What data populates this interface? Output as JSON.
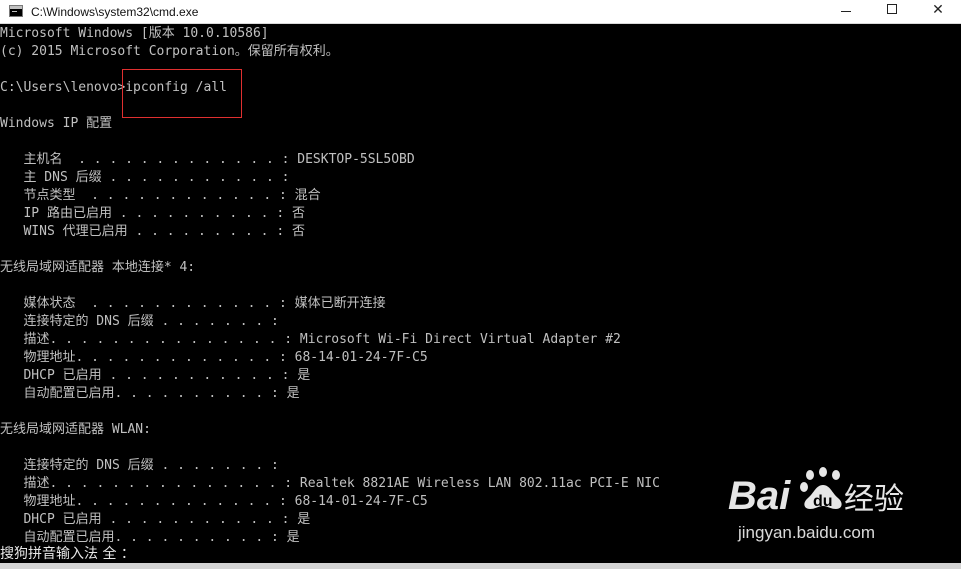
{
  "window": {
    "title": "C:\\Windows\\system32\\cmd.exe",
    "minimize_glyph": "",
    "maximize_glyph": "",
    "close_glyph": "✕"
  },
  "console": {
    "lines": [
      {
        "text": "Microsoft Windows [版本 10.0.10586]"
      },
      {
        "text": "(c) 2015 Microsoft Corporation。保留所有权利。"
      },
      {
        "text": ""
      },
      {
        "text": "C:\\Users\\lenovo>ipconfig /all"
      },
      {
        "text": ""
      },
      {
        "text": "Windows IP 配置"
      },
      {
        "text": ""
      },
      {
        "text": "   主机名  . . . . . . . . . . . . . : DESKTOP-5SL5OBD"
      },
      {
        "text": "   主 DNS 后缀 . . . . . . . . . . . :"
      },
      {
        "text": "   节点类型  . . . . . . . . . . . . : 混合"
      },
      {
        "text": "   IP 路由已启用 . . . . . . . . . . : 否"
      },
      {
        "text": "   WINS 代理已启用 . . . . . . . . . : 否"
      },
      {
        "text": ""
      },
      {
        "text": "无线局域网适配器 本地连接* 4:"
      },
      {
        "text": ""
      },
      {
        "text": "   媒体状态  . . . . . . . . . . . . : 媒体已断开连接"
      },
      {
        "text": "   连接特定的 DNS 后缀 . . . . . . . :"
      },
      {
        "text": "   描述. . . . . . . . . . . . . . . : Microsoft Wi-Fi Direct Virtual Adapter #2"
      },
      {
        "text": "   物理地址. . . . . . . . . . . . . : 68-14-01-24-7F-C5"
      },
      {
        "text": "   DHCP 已启用 . . . . . . . . . . . : 是"
      },
      {
        "text": "   自动配置已启用. . . . . . . . . . : 是"
      },
      {
        "text": ""
      },
      {
        "text": "无线局域网适配器 WLAN:"
      },
      {
        "text": ""
      },
      {
        "text": "   连接特定的 DNS 后缀 . . . . . . . :"
      },
      {
        "text": "   描述. . . . . . . . . . . . . . . : Realtek 8821AE Wireless LAN 802.11ac PCI-E NIC"
      },
      {
        "text": "   物理地址. . . . . . . . . . . . . : 68-14-01-24-7F-C5"
      },
      {
        "text": "   DHCP 已启用 . . . . . . . . . . . : 是"
      },
      {
        "text": "   自动配置已启用. . . . . . . . . . : 是"
      }
    ]
  },
  "ime": {
    "status": "搜狗拼音输入法 全 ："
  },
  "watermark": {
    "logo_text": "Bai 经验",
    "site": "jingyan.baidu.com"
  },
  "colors": {
    "console_bg": "#000000",
    "console_fg": "#c0c0c0",
    "highlight": "#e03030",
    "titlebar_bg": "#ffffff"
  }
}
